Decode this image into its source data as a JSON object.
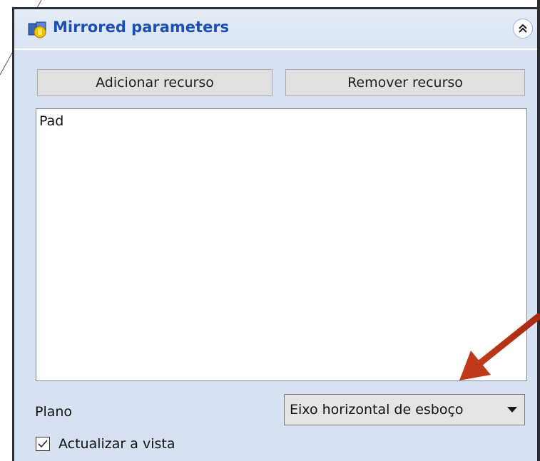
{
  "panel": {
    "title": "Mirrored parameters",
    "icon": "mirrored-feature-icon",
    "collapse_icon": "double-chevron-up-icon"
  },
  "buttons": {
    "add_label": "Adicionar recurso",
    "remove_label": "Remover recurso"
  },
  "feature_list": {
    "items": [
      "Pad"
    ]
  },
  "plane": {
    "label": "Plano",
    "selected": "Eixo horizontal de esboço"
  },
  "update_view": {
    "label": "Actualizar a vista",
    "checked": true
  },
  "colors": {
    "panel_bg": "#d6e1f2",
    "title": "#1a4fb4",
    "annotation_arrow": "#c0391b"
  }
}
